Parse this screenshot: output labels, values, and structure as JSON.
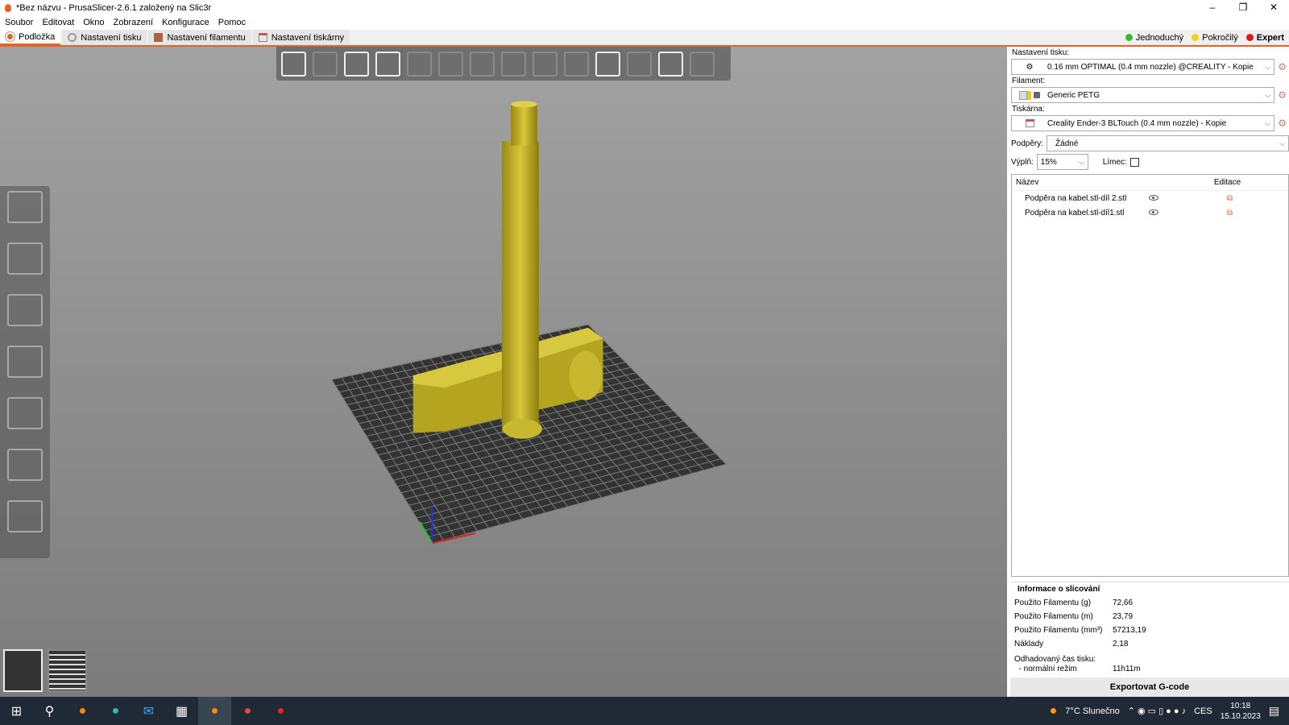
{
  "window": {
    "title": "*Bez názvu - PrusaSlicer-2.6.1 založený na Slic3r",
    "min": "–",
    "max": "❐",
    "close": "✕"
  },
  "menu": [
    "Soubor",
    "Editovat",
    "Okno",
    "Zobrazení",
    "Konfigurace",
    "Pomoc"
  ],
  "tabs": [
    "Podložka",
    "Nastavení tisku",
    "Nastavení filamentu",
    "Nastavení tiskárny"
  ],
  "modes": [
    {
      "label": "Jednoduchý",
      "color": "#2ebd2e"
    },
    {
      "label": "Pokročilý",
      "color": "#e8d51c"
    },
    {
      "label": "Expert",
      "color": "#e01818"
    }
  ],
  "sidebar": {
    "print_label": "Nastavení tisku:",
    "print_value": "0.16 mm OPTIMAL (0.4 mm nozzle) @CREALITY - Kopie",
    "filament_label": "Filament:",
    "filament_value": "Generic PETG",
    "printer_label": "Tiskárna:",
    "printer_value": "Creality Ender-3 BLTouch (0.4 mm nozzle) - Kopie",
    "supports_label": "Podpěry:",
    "supports_value": "Žádné",
    "infill_label": "Výplň:",
    "infill_value": "15%",
    "brim_label": "Límec:",
    "brim_checked": false,
    "col_name": "Název",
    "col_edit": "Editace",
    "objects": [
      "Podpěra na kabel.stl-díl 2.stl",
      "Podpěra na kabel.stl-díl1.stl"
    ]
  },
  "info": {
    "title": "Informace o slicování",
    "rows": [
      {
        "k": "Použito Filamentu (g)",
        "v": "72,66"
      },
      {
        "k": "Použito Filamentu (m)",
        "v": "23,79"
      },
      {
        "k": "Použito Filamentu (mm³)",
        "v": "57213,19"
      },
      {
        "k": "Náklady",
        "v": "2,18"
      },
      {
        "k": "Odhadovaný čas tisku:",
        "v": ""
      },
      {
        "k": "  - normální režim",
        "v": "11h11m"
      }
    ]
  },
  "export_label": "Exportovat G-code",
  "taskbar": {
    "weather": "7°C  Slunečno",
    "lang": "CES",
    "time": "10:18",
    "date": "15.10.2023"
  }
}
